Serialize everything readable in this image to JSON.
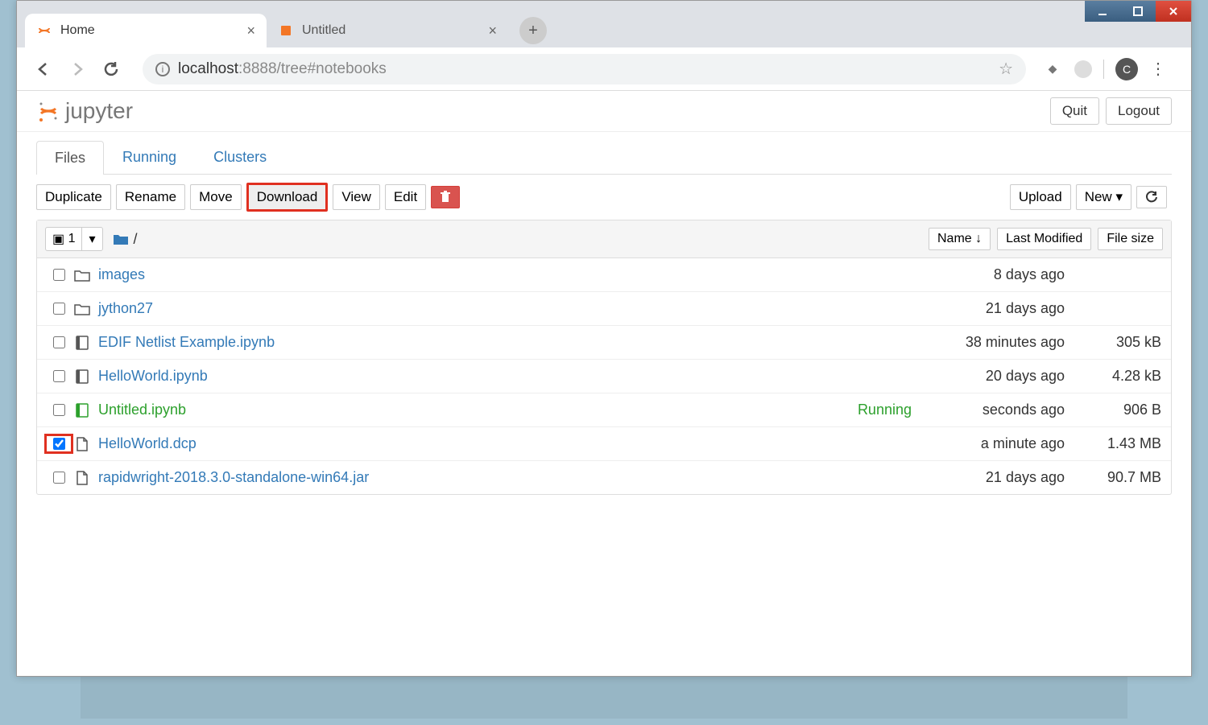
{
  "browser": {
    "tabs": [
      {
        "title": "Home",
        "active": true,
        "icon": "jupyter"
      },
      {
        "title": "Untitled",
        "active": false,
        "icon": "notebook"
      }
    ],
    "url_prefix": "localhost",
    "url_suffix": ":8888/tree#notebooks",
    "profile_initial": "C"
  },
  "header": {
    "logo_text": "jupyter",
    "quit": "Quit",
    "logout": "Logout"
  },
  "tabs": {
    "files": "Files",
    "running": "Running",
    "clusters": "Clusters",
    "active": "files"
  },
  "actions": {
    "duplicate": "Duplicate",
    "rename": "Rename",
    "move": "Move",
    "download": "Download",
    "view": "View",
    "edit": "Edit",
    "upload": "Upload",
    "new": "New"
  },
  "list_header": {
    "selected_count": "1",
    "breadcrumb": "/",
    "name": "Name",
    "last_modified": "Last Modified",
    "file_size": "File size"
  },
  "files": [
    {
      "type": "folder",
      "name": "images",
      "modified": "8 days ago",
      "size": "",
      "checked": false
    },
    {
      "type": "folder",
      "name": "jython27",
      "modified": "21 days ago",
      "size": "",
      "checked": false
    },
    {
      "type": "notebook",
      "name": "EDIF Netlist Example.ipynb",
      "modified": "38 minutes ago",
      "size": "305 kB",
      "checked": false
    },
    {
      "type": "notebook",
      "name": "HelloWorld.ipynb",
      "modified": "20 days ago",
      "size": "4.28 kB",
      "checked": false
    },
    {
      "type": "notebook-running",
      "name": "Untitled.ipynb",
      "status": "Running",
      "modified": "seconds ago",
      "size": "906 B",
      "checked": false
    },
    {
      "type": "file",
      "name": "HelloWorld.dcp",
      "modified": "a minute ago",
      "size": "1.43 MB",
      "checked": true,
      "highlight": true
    },
    {
      "type": "file",
      "name": "rapidwright-2018.3.0-standalone-win64.jar",
      "modified": "21 days ago",
      "size": "90.7 MB",
      "checked": false
    }
  ],
  "highlights": {
    "download": true
  }
}
